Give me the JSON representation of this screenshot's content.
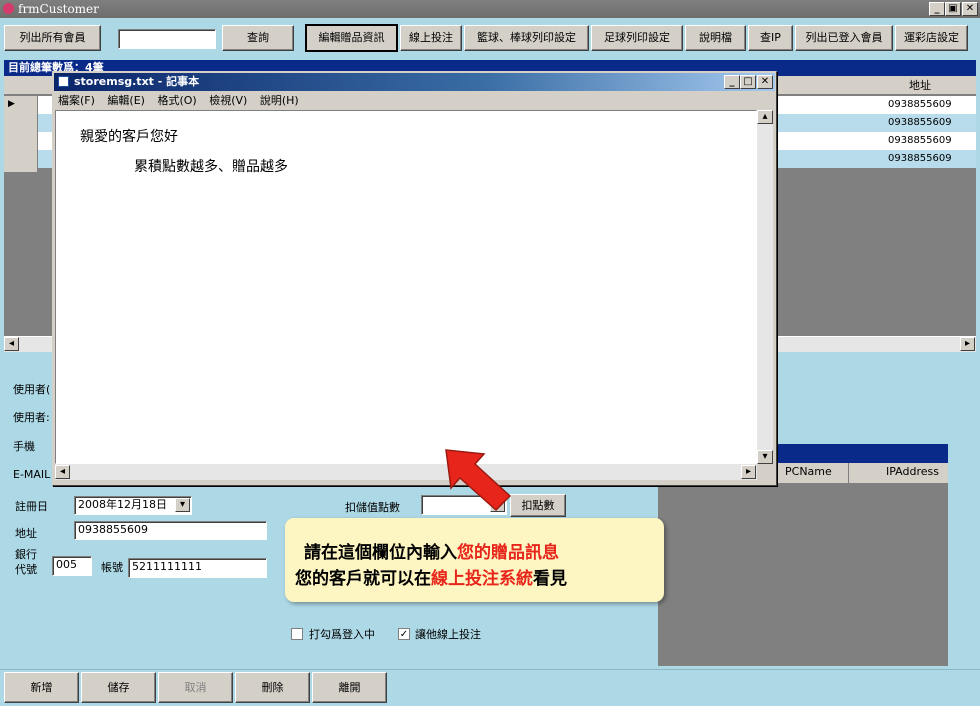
{
  "window": {
    "title": "frmCustomer"
  },
  "toolbar": {
    "buttons": [
      "列出所有會員",
      "查詢",
      "編輯贈品資訊",
      "線上投注",
      "籃球、棒球列印設定",
      "足球列印設定",
      "說明檔",
      "查IP",
      "列出已登入會員",
      "運彩店設定"
    ],
    "search_value": ""
  },
  "grid": {
    "header_text": "目前總筆數爲：4筆",
    "address_header": "地址",
    "rows": [
      "0938855609",
      "0938855609",
      "0938855609",
      "0938855609"
    ]
  },
  "notepad": {
    "title": "storemsg.txt - 記事本",
    "menu": [
      "檔案(F)",
      "編輯(E)",
      "格式(O)",
      "檢視(V)",
      "說明(H)"
    ],
    "line1": "親愛的客戶您好",
    "line2": "累積點數越多、贈品越多"
  },
  "form": {
    "user_label_1": "使用者(",
    "user_label_2": "使用者:",
    "mobile_label": "手機",
    "email_label": "E-MAIL",
    "register_label": "註冊日",
    "register_value": "2008年12月18日",
    "address_label": "地址",
    "address_value": "0938855609",
    "bank_label_1": "銀行",
    "bank_label_2": "代號",
    "bank_value": "005",
    "account_label": "帳號",
    "account_value": "5211111111",
    "deduct_label": "扣儲值點數",
    "deduct_button": "扣點數",
    "checkbox_login": "打勾爲登入中",
    "checkbox_online": "讓他線上投注",
    "checkbox_online_checked": true
  },
  "login_table": {
    "col_pcname": "PCName",
    "col_ip": "IPAddress"
  },
  "callout": {
    "line1_a": "請在這個欄位內輸入",
    "line1_b": "您的贈品訊息",
    "line2_a": "您的客戶就可以在",
    "line2_b": "線上投注系統",
    "line2_c": "看見"
  },
  "bottom_buttons": [
    "新增",
    "儲存",
    "取消",
    "刪除",
    "離開"
  ],
  "colors": {
    "accent_red": "#e8251a",
    "callout_bg": "#fdf5c2",
    "form_bg": "#add8e6"
  }
}
